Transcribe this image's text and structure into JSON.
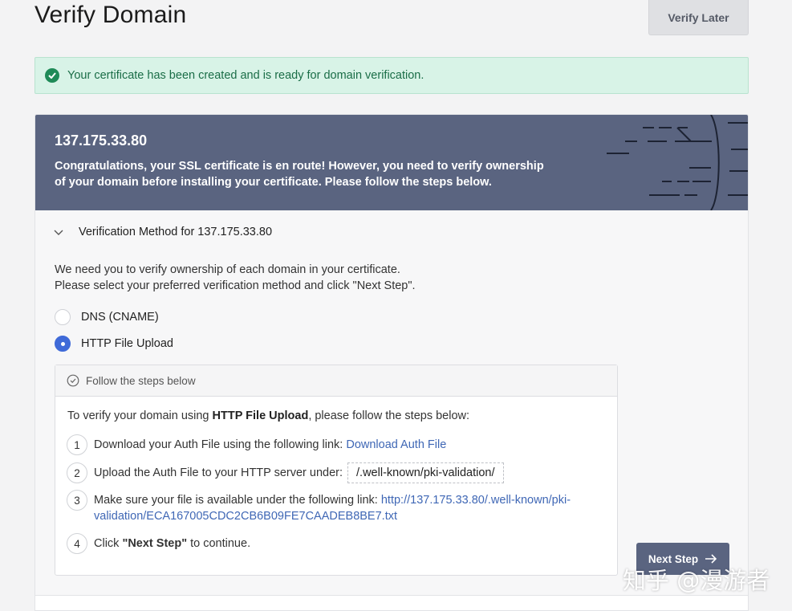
{
  "page": {
    "title": "Verify Domain",
    "verify_later_label": "Verify Later"
  },
  "alert": {
    "text": "Your certificate has been created and is ready for domain verification."
  },
  "card": {
    "domain": "137.175.33.80",
    "message": "Congratulations, your SSL certificate is en route! However, you need to verify ownership of your domain before installing your certificate. Please follow the steps below."
  },
  "verification": {
    "title": "Verification Method for 137.175.33.80",
    "instruction_line1": "We need you to verify ownership of each domain in your certificate.",
    "instruction_line2": "Please select your preferred verification method and click \"Next Step\".",
    "options": [
      {
        "label": "DNS (CNAME)",
        "selected": false
      },
      {
        "label": "HTTP File Upload",
        "selected": true
      }
    ]
  },
  "steps_box": {
    "header": "Follow the steps below",
    "intro_prefix": "To verify your domain using ",
    "intro_bold": "HTTP File Upload",
    "intro_suffix": ", please follow the steps below:",
    "steps": [
      {
        "num": "1",
        "text": "Download your Auth File using the following link: ",
        "link": "Download Auth File"
      },
      {
        "num": "2",
        "text": "Upload the Auth File to your HTTP server under:",
        "path": "/.well-known/pki-validation/"
      },
      {
        "num": "3",
        "text": "Make sure your file is available under the following link: ",
        "link_line1": "http://137.175.33.80/.well-known/pki-",
        "link_line2": "validation/ECA167005CDC2CB6B09FE7CAADEB8BE7.txt"
      },
      {
        "num": "4",
        "text_prefix": "Click ",
        "text_bold": "\"Next Step\"",
        "text_suffix": " to continue."
      }
    ]
  },
  "next_step_label": "Next Step",
  "watermark": "知乎 @漫游者",
  "colors": {
    "header_bg": "#5a6480",
    "alert_bg": "#d8f3e7",
    "alert_text": "#1a6d47",
    "accent": "#3f6ad8",
    "link": "#3f67b5"
  },
  "icons": [
    "check-circle-icon",
    "chevron-down-icon",
    "circle-check-outline-icon",
    "arrow-right-icon"
  ]
}
